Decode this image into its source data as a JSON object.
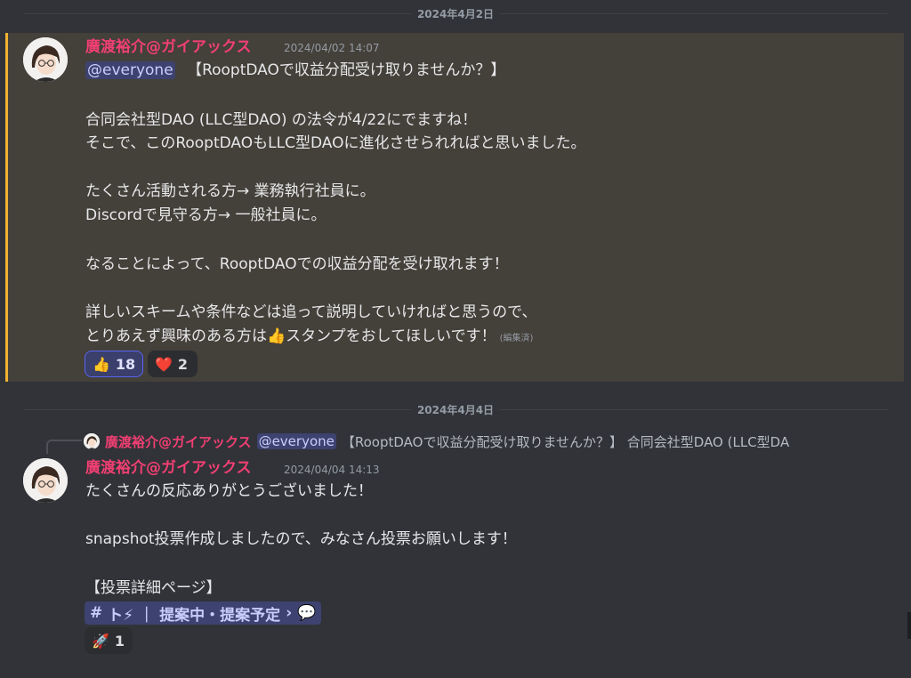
{
  "dividers": {
    "first": "2024年4月2日",
    "second": "2024年4月4日"
  },
  "message1": {
    "username": "廣渡裕介@ガイアックス",
    "timestamp": "2024/04/02 14:07",
    "mention": "@everyone",
    "line1_rest": "【RooptDAOで収益分配受け取りませんか？】",
    "line2": "合同会社型DAO (LLC型DAO) の法令が4/22にでますね！",
    "line3": "そこで、このRooptDAOもLLC型DAOに進化させられればと思いました。",
    "line4": "たくさん活動される方→ 業務執行社員に。",
    "line5": "Discordで見守る方→ 一般社員に。",
    "line6": "なることによって、RooptDAOでの収益分配を受け取れます！",
    "line7": "詳しいスキームや条件などは追って説明していければと思うので、",
    "line8_before": "とりあえず興味のある方は",
    "line8_emoji": "👍",
    "line8_after": "スタンプをおしてほしいです！",
    "edited": "(編集済)",
    "reactions": [
      {
        "emoji": "👍",
        "count": "18",
        "active": true
      },
      {
        "emoji": "❤️",
        "count": "2",
        "active": false
      }
    ]
  },
  "message2": {
    "reply": {
      "username": "廣渡裕介@ガイアックス",
      "mention": "@everyone",
      "preview": "【RooptDAOで収益分配受け取りませんか？】 合同会社型DAO (LLC型DA"
    },
    "username": "廣渡裕介@ガイアックス",
    "timestamp": "2024/04/04 14:13",
    "line1": "たくさんの反応ありがとうございました！",
    "line2": "snapshot投票作成しましたので、みなさん投票お願いします！",
    "line3": "【投票詳細ページ】",
    "channel": {
      "hash": "#",
      "name": "ト⚡",
      "sep": "｜",
      "thread": "提案中・提案予定",
      "chevron": "›",
      "bubble": "💬"
    },
    "reactions": [
      {
        "emoji": "🚀",
        "count": "1",
        "active": false
      }
    ]
  },
  "colors": {
    "background": "#313338",
    "highlight": "#44403a",
    "highlight_bar": "#f0b232",
    "username": "#f23f73",
    "mention_bg": "#3e4270"
  }
}
